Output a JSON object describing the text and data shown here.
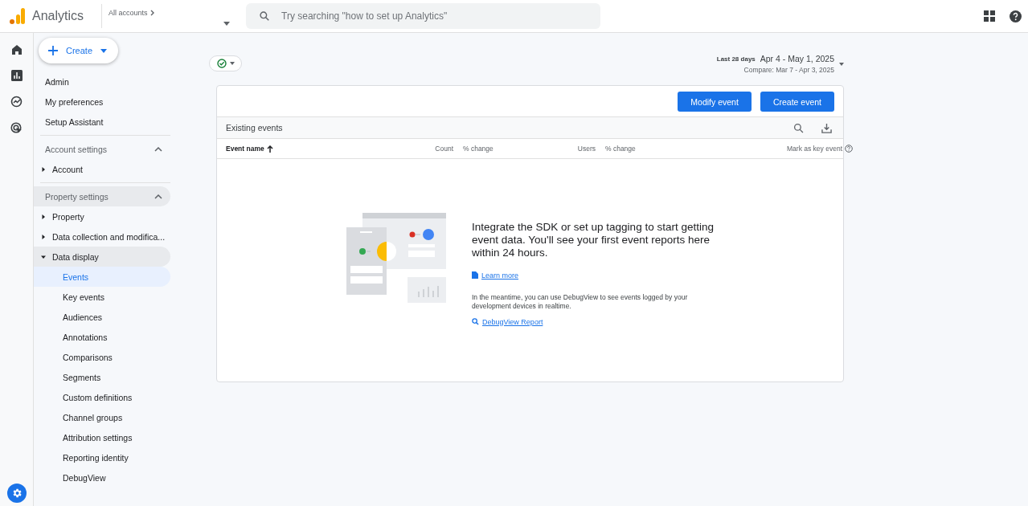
{
  "header": {
    "product": "Analytics",
    "account_link": "All accounts",
    "search": {
      "placeholder": "Try searching \"how to set up Analytics\""
    }
  },
  "sidebar": {
    "create": "Create",
    "links": [
      {
        "label": "Admin"
      },
      {
        "label": "My preferences"
      },
      {
        "label": "Setup Assistant"
      }
    ],
    "sections": [
      {
        "title": "Account settings",
        "expanded": true,
        "selected": false,
        "items": [
          {
            "label": "Account",
            "expanded": false,
            "selected": false
          }
        ]
      },
      {
        "title": "Property settings",
        "expanded": true,
        "selected": true,
        "items": [
          {
            "label": "Property",
            "expanded": false,
            "selected": false
          },
          {
            "label": "Data collection and modifica...",
            "expanded": false,
            "selected": false
          },
          {
            "label": "Data display",
            "expanded": true,
            "selected": true,
            "children": [
              {
                "label": "Events",
                "selected": true
              },
              {
                "label": "Key events",
                "selected": false
              },
              {
                "label": "Audiences",
                "selected": false
              },
              {
                "label": "Annotations",
                "selected": false
              },
              {
                "label": "Comparisons",
                "selected": false
              },
              {
                "label": "Segments",
                "selected": false
              },
              {
                "label": "Custom definitions",
                "selected": false
              },
              {
                "label": "Channel groups",
                "selected": false
              },
              {
                "label": "Attribution settings",
                "selected": false
              },
              {
                "label": "Reporting identity",
                "selected": false
              },
              {
                "label": "DebugView",
                "selected": false
              }
            ]
          }
        ]
      }
    ]
  },
  "date_range": {
    "preset": "Last 28 days",
    "range": "Apr 4 - May 1, 2025",
    "compare": "Compare: Mar 7 - Apr 3, 2025"
  },
  "card": {
    "buttons": [
      "Modify event",
      "Create event"
    ],
    "title": "Existing events",
    "columns": [
      {
        "label": "Event name",
        "kind": "sort"
      },
      {
        "label": "Count",
        "kind": "num"
      },
      {
        "label": "% change",
        "kind": "change"
      },
      {
        "label": "Users",
        "kind": "num"
      },
      {
        "label": "% change",
        "kind": "change"
      },
      {
        "label": "Mark as key event",
        "kind": "help"
      }
    ],
    "empty": {
      "headline": "Integrate the SDK or set up tagging to start getting event data. You'll see your first event reports here within 24 hours.",
      "learn_more": "Learn more",
      "note": "In the meantime, you can use DebugView to see events logged by your development devices in realtime.",
      "debug_link": "DebugView Report"
    }
  }
}
